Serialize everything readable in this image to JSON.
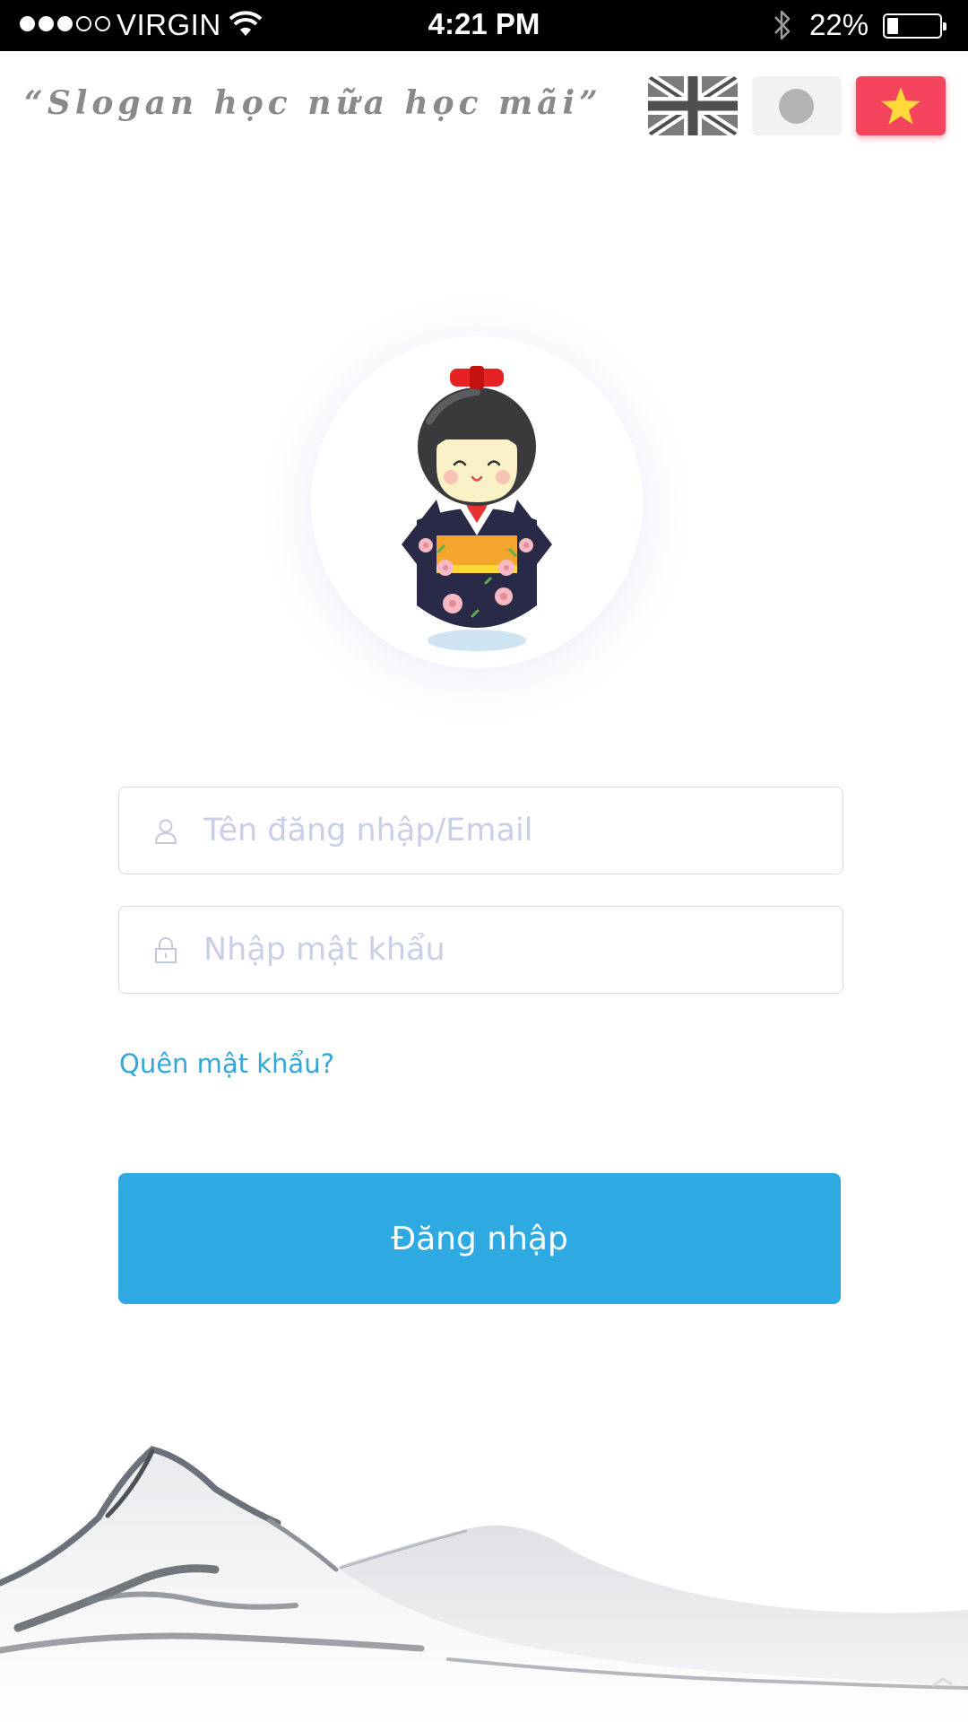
{
  "status_bar": {
    "carrier": "VIRGIN",
    "time": "4:21 PM",
    "battery_text": "22%",
    "battery_level": 0.22,
    "signal_bars": 3,
    "signal_total": 5,
    "icons": [
      "signal-dots-icon",
      "wifi-icon",
      "bluetooth-icon",
      "battery-icon"
    ]
  },
  "header": {
    "slogan": "“Slogan học nữa học mãi”",
    "languages": [
      {
        "id": "en",
        "icon": "uk-flag-icon"
      },
      {
        "id": "jp",
        "icon": "japan-flag-icon"
      },
      {
        "id": "vn",
        "icon": "vietnam-flag-icon",
        "selected": true
      }
    ]
  },
  "avatar": {
    "icon": "kokeshi-doll-icon"
  },
  "form": {
    "username": {
      "placeholder": "Tên đăng nhập/Email",
      "value": "",
      "icon": "user-icon"
    },
    "password": {
      "placeholder": "Nhập mật khẩu",
      "value": "",
      "icon": "lock-icon"
    },
    "forgot_label": "Quên mật khẩu?",
    "login_label": "Đăng nhập"
  },
  "colors": {
    "accent": "#2ea9e1",
    "link": "#33a7dc",
    "selected_language": "#f5445e",
    "placeholder": "#c9cfe6",
    "slogan": "#8a8a8a"
  }
}
